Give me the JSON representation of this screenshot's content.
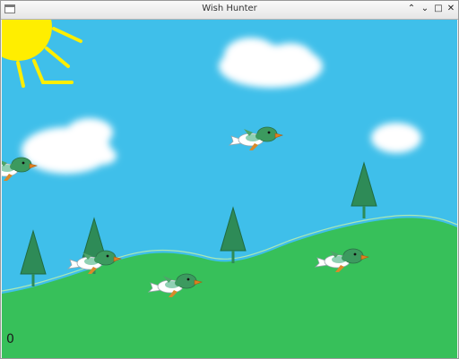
{
  "window": {
    "title": "Wish Hunter",
    "controls": {
      "shade": "⌃",
      "minimize": "⌄",
      "maximize": "□",
      "close": "✕"
    }
  },
  "game": {
    "score": "0",
    "colors": {
      "sky": "#3fbfea",
      "grass": "#37c05a",
      "sun": "#ffee00",
      "cloud": "#ffffff",
      "tree": "#2e8b57",
      "duck_head": "#3c9a5f",
      "duck_body": "#ffffff",
      "duck_beak": "#e08020"
    },
    "sprites": {
      "sun": "sun-icon",
      "cloud": "cloud-icon",
      "tree": "pine-tree-icon",
      "duck": "duck-icon"
    }
  }
}
